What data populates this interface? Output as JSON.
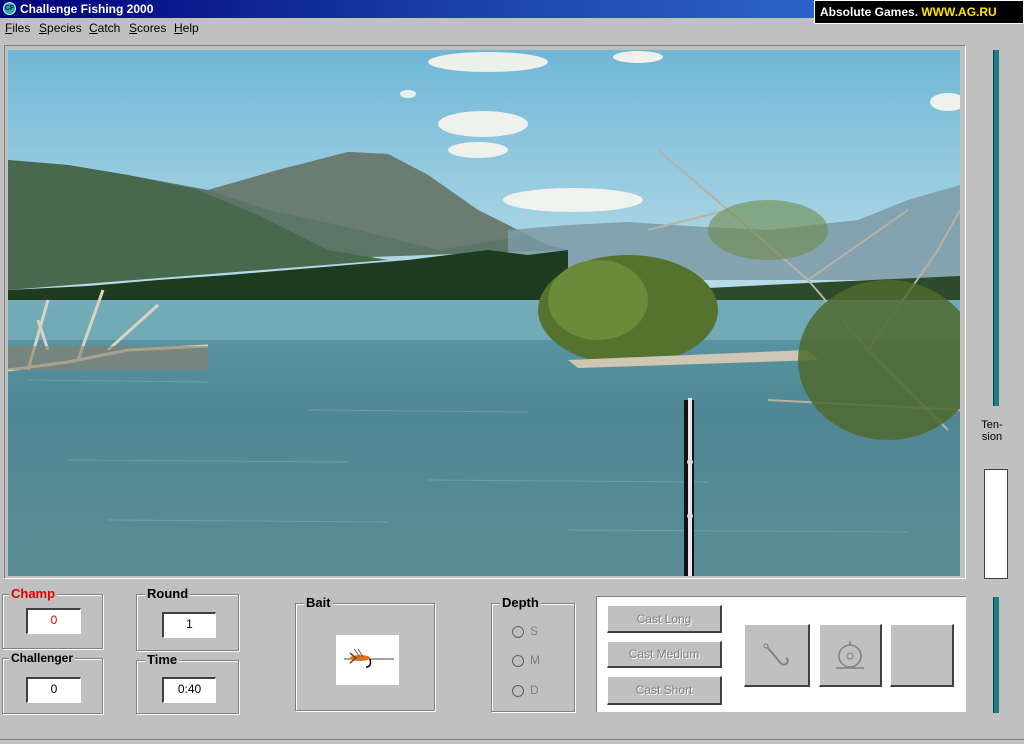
{
  "window": {
    "title": "Challenge Fishing 2000",
    "icon": "app-globe-icon",
    "icon_label": "CF"
  },
  "banner": {
    "prefix": "Absolute Games. ",
    "highlight": "WWW.AG.RU",
    "highlight_color": "#ffe400"
  },
  "menu": [
    {
      "label": "Files"
    },
    {
      "label": "Species"
    },
    {
      "label": "Catch"
    },
    {
      "label": "Scores"
    },
    {
      "label": "Help"
    }
  ],
  "tension": {
    "label_line1": "Ten-",
    "label_line2": "sion",
    "color": "#1d7d82"
  },
  "scores": {
    "champ_label": "Champ",
    "champ_value": "0",
    "challenger_label": "Challenger",
    "challenger_value": "0",
    "champ_color": "#e00000"
  },
  "round": {
    "label": "Round",
    "value": "1"
  },
  "time": {
    "label": "Time",
    "value": "0:40"
  },
  "bait": {
    "label": "Bait",
    "icon": "fly-lure-icon"
  },
  "depth": {
    "label": "Depth",
    "options": [
      {
        "label": "S"
      },
      {
        "label": "M"
      },
      {
        "label": "D"
      }
    ]
  },
  "cast": {
    "long_label": "Cast Long",
    "medium_label": "Cast Medium",
    "short_label": "Cast Short"
  },
  "actions": [
    {
      "icon": "hook-icon"
    },
    {
      "icon": "reel-icon"
    },
    {
      "icon": ""
    }
  ]
}
